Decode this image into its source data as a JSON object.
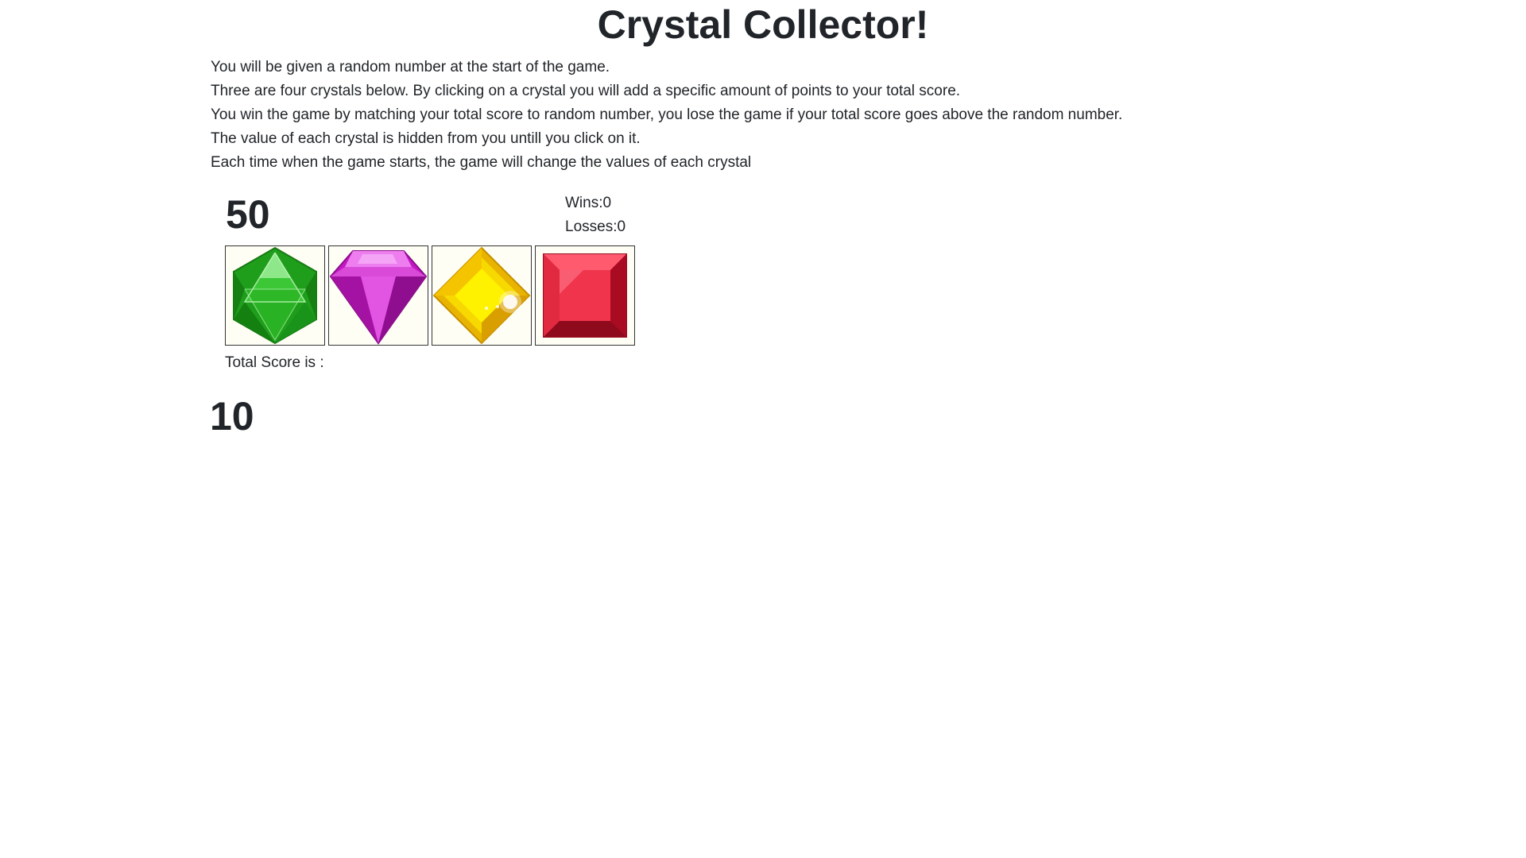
{
  "game": {
    "title": "Crystal Collector!",
    "instructions": [
      "You will be given a random number at the start of the game.",
      "Three are four crystals below. By clicking on a crystal you will add a specific amount of points to your total score.",
      "You win the game by matching your total score to random number, you lose the game if your total score goes above the random number.",
      "The value of each crystal is hidden from you untill you click on it.",
      "Each time when the game starts, the game will change the values of each crystal"
    ],
    "target_number": "50",
    "wins_label": "Wins:0",
    "losses_label": "Losses:0",
    "total_label": "Total Score is :",
    "total_score": "10",
    "crystals": [
      {
        "icon": "green-crystal-icon",
        "color": "#22b01e"
      },
      {
        "icon": "purple-crystal-icon",
        "color": "#d21cd2"
      },
      {
        "icon": "yellow-crystal-icon",
        "color": "#f3d40a"
      },
      {
        "icon": "red-crystal-icon",
        "color": "#e8213a"
      }
    ]
  }
}
